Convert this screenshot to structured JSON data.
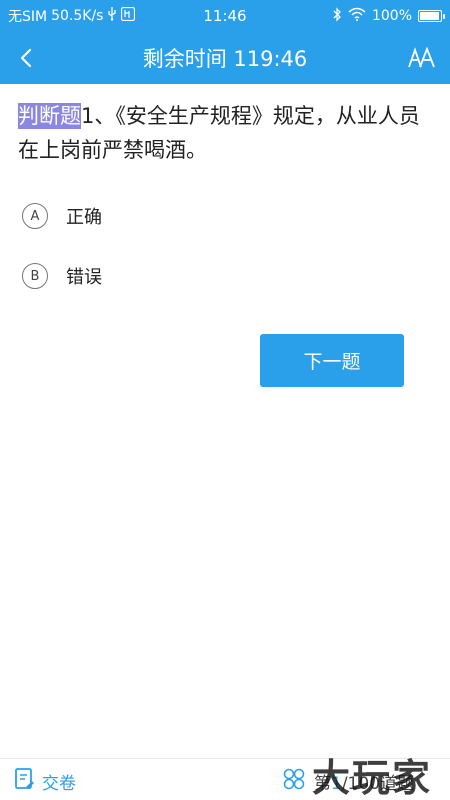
{
  "status_bar": {
    "carrier": "无SIM",
    "speed": "50.5K/s",
    "time": "11:46",
    "battery": "100%",
    "battery_level": 1.0,
    "icons": [
      "usb-icon",
      "notification-icon",
      "bluetooth-icon",
      "wifi-icon",
      "battery-icon"
    ]
  },
  "nav": {
    "title": "剩余时间 119:46",
    "back_icon": "chevron-left-icon",
    "font_icon": "font-size-icon"
  },
  "question": {
    "type": "判断题",
    "text": "1、《安全生产规程》规定，从业人员在上岗前严禁喝酒。"
  },
  "options": [
    {
      "letter": "A",
      "text": "正确"
    },
    {
      "letter": "B",
      "text": "错误"
    }
  ],
  "next_button": "下一题",
  "bottom": {
    "submit_label": "交卷",
    "submit_icon": "exam-paper-icon",
    "progress_icon": "grid-icon",
    "progress_prefix": "第",
    "progress_current": "1",
    "progress_rest": "/100道题"
  },
  "watermark": "大玩家",
  "colors": {
    "primary": "#2aa0ea",
    "highlight": "#8b86e0"
  }
}
